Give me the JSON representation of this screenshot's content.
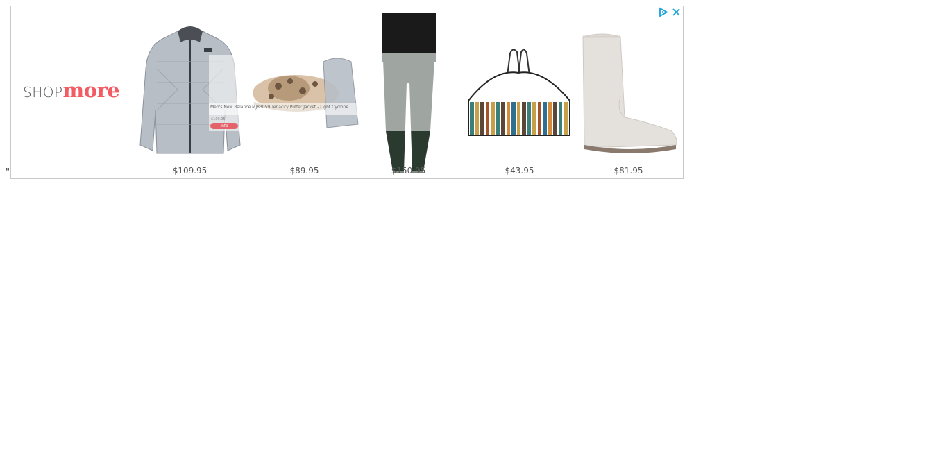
{
  "page": {
    "stray_char": "\""
  },
  "ad": {
    "brand": {
      "shop": "SHOP",
      "more": "more"
    },
    "controls": {
      "adchoices_icon": "adchoices-icon",
      "close_icon": "close-icon"
    },
    "products": [
      {
        "name": "jacket",
        "price": "$109.95"
      },
      {
        "name": "slippers",
        "price": "$89.95"
      },
      {
        "name": "pants",
        "price": "$150.95"
      },
      {
        "name": "bikini-top",
        "price": "$43.95"
      },
      {
        "name": "boots",
        "price": "$81.95"
      }
    ],
    "tooltip": {
      "title": "Men's New Balance MJ83059 Tenacity Puffer Jacket - Light Cyclone",
      "price": "$109.95",
      "button": "Info"
    },
    "colors": {
      "accent": "#f25b62",
      "adchoices": "#1aa3d9",
      "border": "#c9c9c9"
    }
  }
}
